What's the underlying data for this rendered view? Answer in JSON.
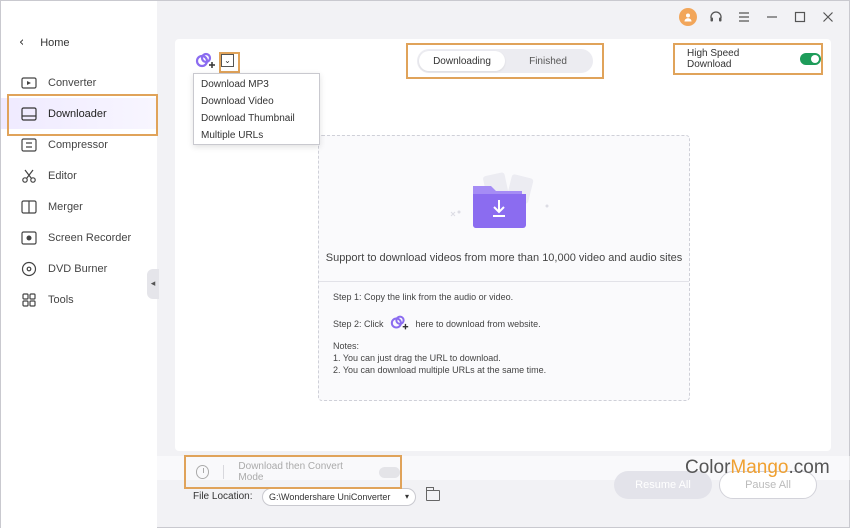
{
  "sidebar": {
    "home_label": "Home",
    "items": [
      {
        "label": "Converter",
        "icon": "converter-icon"
      },
      {
        "label": "Downloader",
        "icon": "downloader-icon",
        "active": true
      },
      {
        "label": "Compressor",
        "icon": "compressor-icon"
      },
      {
        "label": "Editor",
        "icon": "scissors-icon"
      },
      {
        "label": "Merger",
        "icon": "merger-icon"
      },
      {
        "label": "Screen Recorder",
        "icon": "screen-recorder-icon"
      },
      {
        "label": "DVD Burner",
        "icon": "disc-icon"
      },
      {
        "label": "Tools",
        "icon": "grid-icon"
      }
    ]
  },
  "titlebar": {
    "icons": [
      "user-icon",
      "headset-icon",
      "menu-icon",
      "minimize-icon",
      "maximize-icon",
      "close-icon"
    ]
  },
  "toolbar": {
    "tabs": [
      {
        "label": "Downloading",
        "active": true
      },
      {
        "label": "Finished",
        "active": false
      }
    ],
    "high_speed_label": "High Speed Download",
    "high_speed_on": true
  },
  "dropdown": {
    "items": [
      "Download MP3",
      "Download Video",
      "Download Thumbnail",
      "Multiple URLs"
    ]
  },
  "drop_area": {
    "support_text": "Support to download videos from more than 10,000 video and audio sites",
    "step1": "Step 1: Copy the link from the audio or video.",
    "step2_prefix": "Step 2: Click",
    "step2_suffix": "here to download from website.",
    "notes_title": "Notes:",
    "note1": "1. You can just drag the URL to download.",
    "note2": "2. You can download multiple URLs at the same time."
  },
  "bottom": {
    "convert_mode_label": "Download then Convert Mode",
    "convert_mode_on": false,
    "file_location_label": "File Location:",
    "file_location_value": "G:\\Wondershare UniConverter",
    "resume_label": "Resume All",
    "pause_label": "Pause All"
  },
  "watermark": {
    "part1": "Color",
    "part2": "Mango",
    "part3": ".com"
  },
  "colors": {
    "accent_purple": "#8b6cf0",
    "highlight_orange": "#e0a35a",
    "toggle_green": "#1e9c5a"
  }
}
